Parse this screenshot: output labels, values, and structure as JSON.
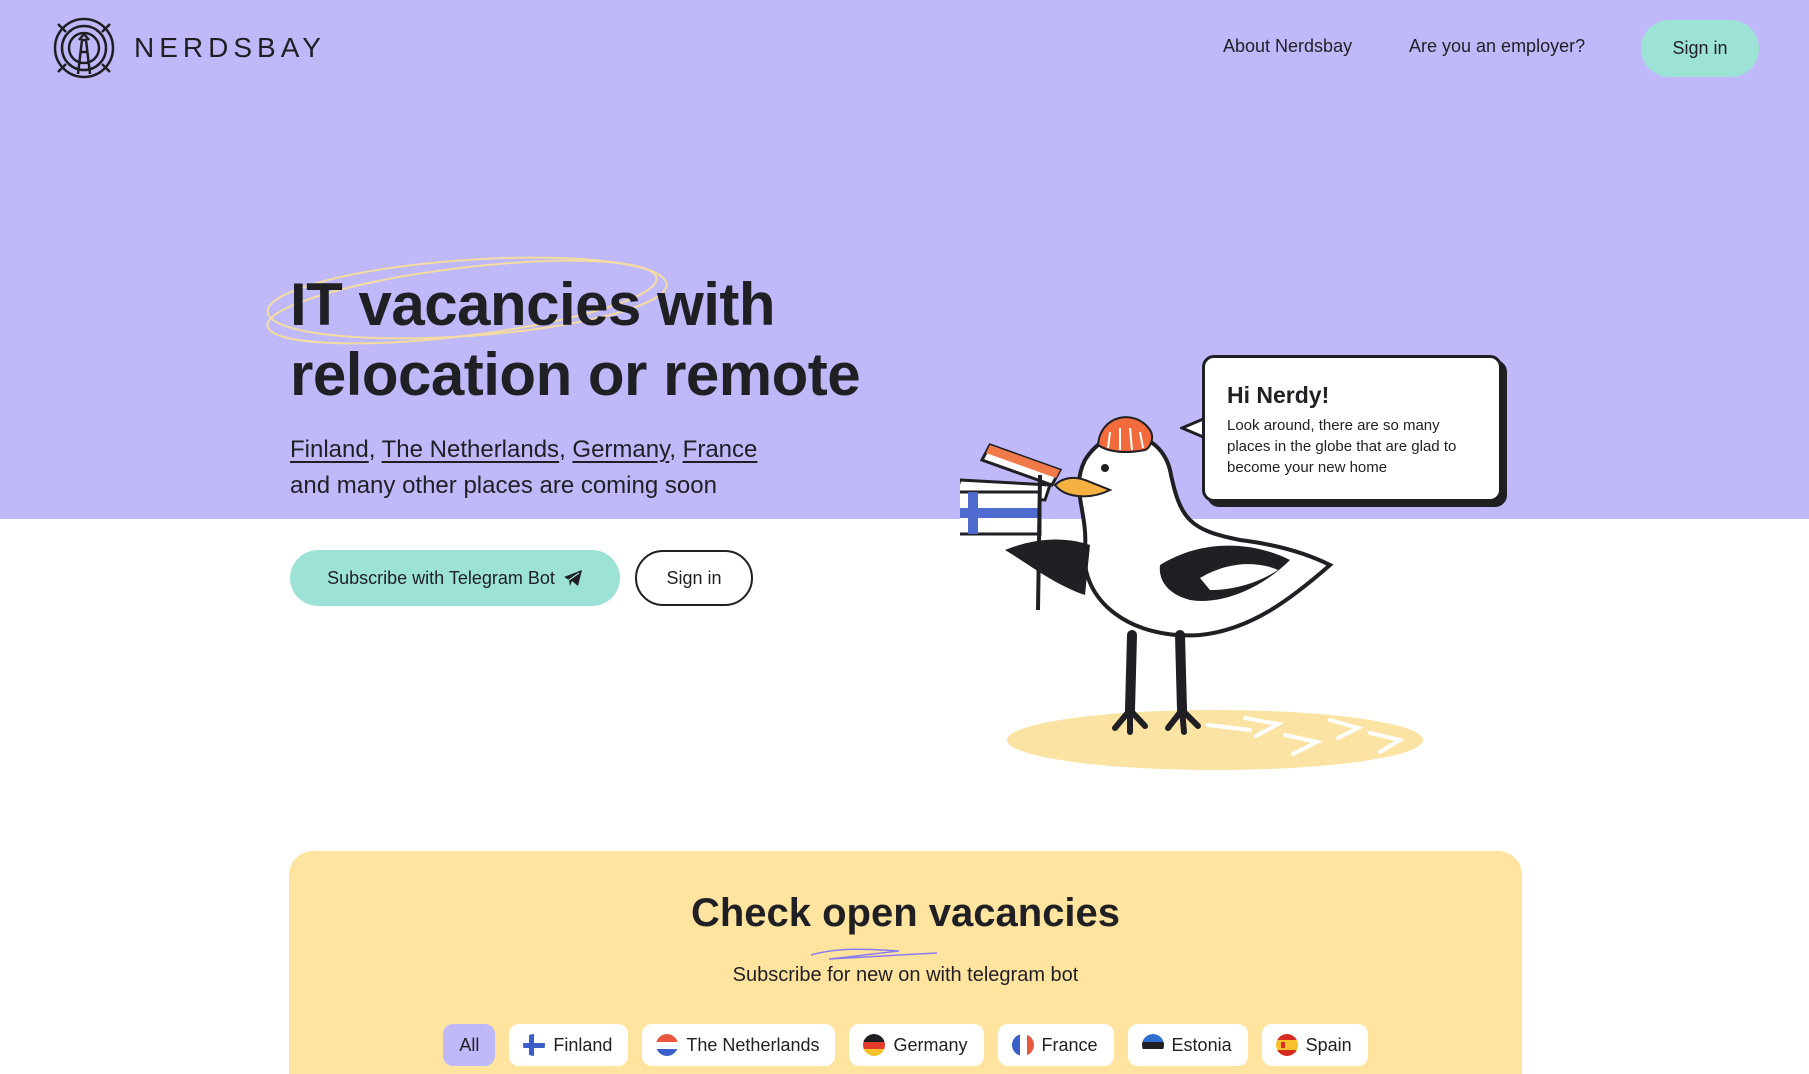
{
  "brand": {
    "name": "NERDSBAY"
  },
  "nav": {
    "about": "About Nerdsbay",
    "employer": "Are you an employer?",
    "sign_in": "Sign in"
  },
  "hero": {
    "headline_line1_highlight": "IT vacancies",
    "headline_line1_rest": " with",
    "headline_line2": "relocation or remote",
    "countries": [
      "Finland",
      "The Netherlands",
      "Germany",
      "France"
    ],
    "coming_soon": "and many other places are coming soon",
    "cta_telegram": "Subscribe with Telegram Bot",
    "cta_sign_in": "Sign in"
  },
  "bubble": {
    "title": "Hi Nerdy!",
    "text": "Look around, there are so many places in the globe that are glad to become your new home"
  },
  "vacancies": {
    "title_before": "Check ",
    "title_highlight": "open",
    "title_after": " vacancies",
    "subtitle": "Subscribe for new on with telegram bot",
    "filters": [
      {
        "label": "All",
        "active": true,
        "flag": ""
      },
      {
        "label": "Finland",
        "active": false,
        "flag": "finland-flag-icon"
      },
      {
        "label": "The Netherlands",
        "active": false,
        "flag": "netherlands-flag-icon"
      },
      {
        "label": "Germany",
        "active": false,
        "flag": "germany-flag-icon"
      },
      {
        "label": "France",
        "active": false,
        "flag": "france-flag-icon"
      },
      {
        "label": "Estonia",
        "active": false,
        "flag": "estonia-flag-icon"
      },
      {
        "label": "Spain",
        "active": false,
        "flag": "spain-flag-icon"
      }
    ]
  },
  "colors": {
    "hero_bg": "#bfb9fa",
    "accent_mint": "#9de3d5",
    "card_yellow": "#ffe4a0",
    "text": "#1f1f24"
  }
}
